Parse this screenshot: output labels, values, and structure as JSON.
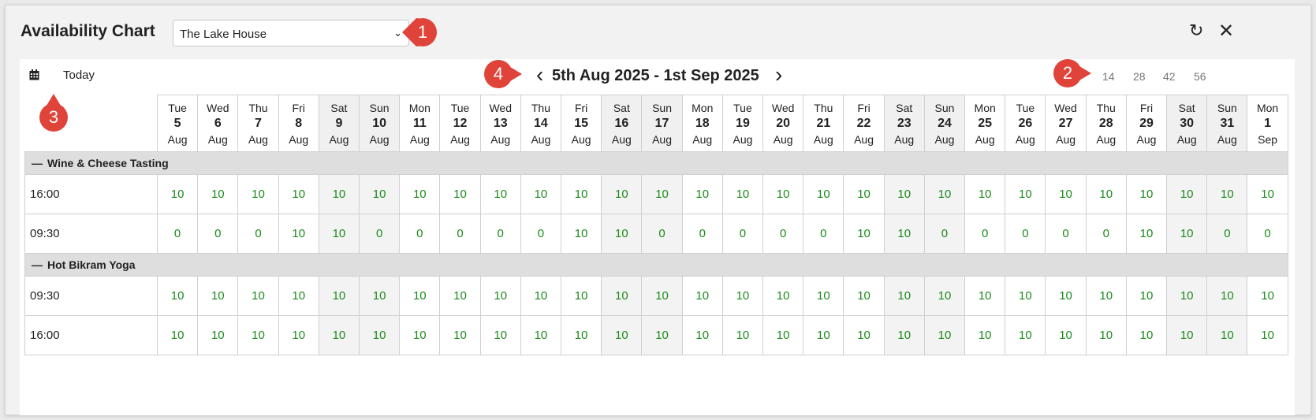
{
  "title": "Availability Chart",
  "property_select": {
    "value": "The Lake House"
  },
  "toolbar": {
    "today_label": "Today",
    "range_label": "5th Aug 2025 - 1st Sep 2025",
    "span_options": [
      "14",
      "28",
      "42",
      "56"
    ]
  },
  "icons": {
    "refresh": "refresh-icon",
    "close": "close-icon",
    "calendar": "calendar-icon",
    "prev": "chevron-left-icon",
    "next": "chevron-right-icon"
  },
  "colors": {
    "availability": "#1c8a1c",
    "callout": "#e0433a",
    "weekend_bg": "#f0f0f0",
    "group_bg": "#dedede"
  },
  "days": [
    {
      "dow": "Tue",
      "d": "5",
      "m": "Aug"
    },
    {
      "dow": "Wed",
      "d": "6",
      "m": "Aug"
    },
    {
      "dow": "Thu",
      "d": "7",
      "m": "Aug"
    },
    {
      "dow": "Fri",
      "d": "8",
      "m": "Aug"
    },
    {
      "dow": "Sat",
      "d": "9",
      "m": "Aug"
    },
    {
      "dow": "Sun",
      "d": "10",
      "m": "Aug"
    },
    {
      "dow": "Mon",
      "d": "11",
      "m": "Aug"
    },
    {
      "dow": "Tue",
      "d": "12",
      "m": "Aug"
    },
    {
      "dow": "Wed",
      "d": "13",
      "m": "Aug"
    },
    {
      "dow": "Thu",
      "d": "14",
      "m": "Aug"
    },
    {
      "dow": "Fri",
      "d": "15",
      "m": "Aug"
    },
    {
      "dow": "Sat",
      "d": "16",
      "m": "Aug"
    },
    {
      "dow": "Sun",
      "d": "17",
      "m": "Aug"
    },
    {
      "dow": "Mon",
      "d": "18",
      "m": "Aug"
    },
    {
      "dow": "Tue",
      "d": "19",
      "m": "Aug"
    },
    {
      "dow": "Wed",
      "d": "20",
      "m": "Aug"
    },
    {
      "dow": "Thu",
      "d": "21",
      "m": "Aug"
    },
    {
      "dow": "Fri",
      "d": "22",
      "m": "Aug"
    },
    {
      "dow": "Sat",
      "d": "23",
      "m": "Aug"
    },
    {
      "dow": "Sun",
      "d": "24",
      "m": "Aug"
    },
    {
      "dow": "Mon",
      "d": "25",
      "m": "Aug"
    },
    {
      "dow": "Tue",
      "d": "26",
      "m": "Aug"
    },
    {
      "dow": "Wed",
      "d": "27",
      "m": "Aug"
    },
    {
      "dow": "Thu",
      "d": "28",
      "m": "Aug"
    },
    {
      "dow": "Fri",
      "d": "29",
      "m": "Aug"
    },
    {
      "dow": "Sat",
      "d": "30",
      "m": "Aug"
    },
    {
      "dow": "Sun",
      "d": "31",
      "m": "Aug"
    },
    {
      "dow": "Mon",
      "d": "1",
      "m": "Sep"
    }
  ],
  "groups": [
    {
      "name": "Wine & Cheese Tasting",
      "collapse_symbol": "—",
      "rows": [
        {
          "time": "16:00",
          "values": [
            "10",
            "10",
            "10",
            "10",
            "10",
            "10",
            "10",
            "10",
            "10",
            "10",
            "10",
            "10",
            "10",
            "10",
            "10",
            "10",
            "10",
            "10",
            "10",
            "10",
            "10",
            "10",
            "10",
            "10",
            "10",
            "10",
            "10",
            "10"
          ]
        },
        {
          "time": "09:30",
          "values": [
            "0",
            "0",
            "0",
            "10",
            "10",
            "0",
            "0",
            "0",
            "0",
            "0",
            "10",
            "10",
            "0",
            "0",
            "0",
            "0",
            "0",
            "10",
            "10",
            "0",
            "0",
            "0",
            "0",
            "0",
            "10",
            "10",
            "0",
            "0"
          ]
        }
      ]
    },
    {
      "name": "Hot Bikram Yoga",
      "collapse_symbol": "—",
      "rows": [
        {
          "time": "09:30",
          "values": [
            "10",
            "10",
            "10",
            "10",
            "10",
            "10",
            "10",
            "10",
            "10",
            "10",
            "10",
            "10",
            "10",
            "10",
            "10",
            "10",
            "10",
            "10",
            "10",
            "10",
            "10",
            "10",
            "10",
            "10",
            "10",
            "10",
            "10",
            "10"
          ]
        },
        {
          "time": "16:00",
          "values": [
            "10",
            "10",
            "10",
            "10",
            "10",
            "10",
            "10",
            "10",
            "10",
            "10",
            "10",
            "10",
            "10",
            "10",
            "10",
            "10",
            "10",
            "10",
            "10",
            "10",
            "10",
            "10",
            "10",
            "10",
            "10",
            "10",
            "10",
            "10"
          ]
        }
      ]
    }
  ],
  "callouts": [
    "1",
    "2",
    "3",
    "4"
  ]
}
